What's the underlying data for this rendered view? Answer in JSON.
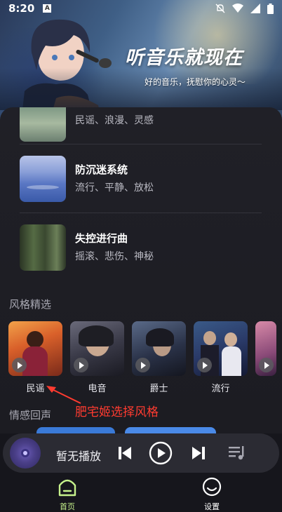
{
  "status_bar": {
    "time": "8:20"
  },
  "hero": {
    "title": "听音乐就现在",
    "subtitle": "好的音乐，抚慰你的心灵～"
  },
  "playlists": [
    {
      "title": "",
      "tags": "民谣、浪漫、灵感"
    },
    {
      "title": "防沉迷系统",
      "tags": "流行、平静、放松"
    },
    {
      "title": "失控进行曲",
      "tags": "摇滚、悲伤、神秘"
    }
  ],
  "sections": {
    "styles": "风格精选",
    "emotions": "情感回声"
  },
  "styles": [
    {
      "label": "民谣"
    },
    {
      "label": "电音"
    },
    {
      "label": "爵士"
    },
    {
      "label": "流行"
    },
    {
      "label": ""
    }
  ],
  "annotation": "肥宅姬选择风格",
  "player": {
    "now_playing": "暂无播放"
  },
  "nav": {
    "home": "首页",
    "settings": "设置"
  },
  "colors": {
    "accent": "#c6f28c",
    "annotation": "#ff3b30",
    "background": "#16161c"
  }
}
